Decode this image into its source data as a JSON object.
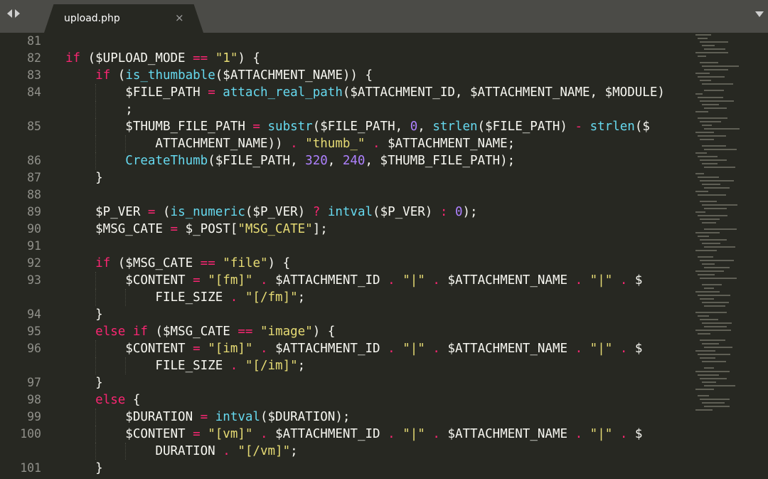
{
  "tab": {
    "title": "upload.php",
    "close": "×"
  },
  "lines": [
    {
      "n": "81",
      "segs": []
    },
    {
      "n": "82",
      "segs": [
        [
          "kw",
          "if"
        ],
        [
          "p",
          " ($UPLOAD_MODE "
        ],
        [
          "op",
          "=="
        ],
        [
          "p",
          " "
        ],
        [
          "str",
          "\"1\""
        ],
        [
          "p",
          ") {"
        ]
      ]
    },
    {
      "n": "83",
      "segs": [
        [
          "p",
          "    "
        ],
        [
          "kw",
          "if"
        ],
        [
          "p",
          " ("
        ],
        [
          "fn",
          "is_thumbable"
        ],
        [
          "p",
          "($ATTACHMENT_NAME)) {"
        ]
      ]
    },
    {
      "n": "84",
      "segs": [
        [
          "p",
          "        $FILE_PATH "
        ],
        [
          "op",
          "="
        ],
        [
          "p",
          " "
        ],
        [
          "fn",
          "attach_real_path"
        ],
        [
          "p",
          "($ATTACHMENT_ID, $ATTACHMENT_NAME, $MODULE)"
        ]
      ]
    },
    {
      "n": "",
      "segs": [
        [
          "p",
          "        ;"
        ]
      ]
    },
    {
      "n": "85",
      "segs": [
        [
          "p",
          "        $THUMB_FILE_PATH "
        ],
        [
          "op",
          "="
        ],
        [
          "p",
          " "
        ],
        [
          "fn",
          "substr"
        ],
        [
          "p",
          "($FILE_PATH, "
        ],
        [
          "num",
          "0"
        ],
        [
          "p",
          ", "
        ],
        [
          "fn",
          "strlen"
        ],
        [
          "p",
          "($FILE_PATH) "
        ],
        [
          "op",
          "-"
        ],
        [
          "p",
          " "
        ],
        [
          "fn",
          "strlen"
        ],
        [
          "p",
          "($"
        ]
      ]
    },
    {
      "n": "",
      "segs": [
        [
          "p",
          "            ATTACHMENT_NAME)) "
        ],
        [
          "op",
          "."
        ],
        [
          "p",
          " "
        ],
        [
          "str",
          "\"thumb_\""
        ],
        [
          "p",
          " "
        ],
        [
          "op",
          "."
        ],
        [
          "p",
          " $ATTACHMENT_NAME;"
        ]
      ]
    },
    {
      "n": "86",
      "segs": [
        [
          "p",
          "        "
        ],
        [
          "fn",
          "CreateThumb"
        ],
        [
          "p",
          "($FILE_PATH, "
        ],
        [
          "num",
          "320"
        ],
        [
          "p",
          ", "
        ],
        [
          "num",
          "240"
        ],
        [
          "p",
          ", $THUMB_FILE_PATH);"
        ]
      ]
    },
    {
      "n": "87",
      "segs": [
        [
          "p",
          "    }"
        ]
      ]
    },
    {
      "n": "88",
      "segs": []
    },
    {
      "n": "89",
      "segs": [
        [
          "p",
          "    $P_VER "
        ],
        [
          "op",
          "="
        ],
        [
          "p",
          " ("
        ],
        [
          "fn",
          "is_numeric"
        ],
        [
          "p",
          "($P_VER) "
        ],
        [
          "op",
          "?"
        ],
        [
          "p",
          " "
        ],
        [
          "fn",
          "intval"
        ],
        [
          "p",
          "($P_VER) "
        ],
        [
          "op",
          ":"
        ],
        [
          "p",
          " "
        ],
        [
          "num",
          "0"
        ],
        [
          "p",
          ");"
        ]
      ]
    },
    {
      "n": "90",
      "segs": [
        [
          "p",
          "    $MSG_CATE "
        ],
        [
          "op",
          "="
        ],
        [
          "p",
          " $_POST["
        ],
        [
          "str",
          "\"MSG_CATE\""
        ],
        [
          "p",
          "];"
        ]
      ]
    },
    {
      "n": "91",
      "segs": []
    },
    {
      "n": "92",
      "segs": [
        [
          "p",
          "    "
        ],
        [
          "kw",
          "if"
        ],
        [
          "p",
          " ($MSG_CATE "
        ],
        [
          "op",
          "=="
        ],
        [
          "p",
          " "
        ],
        [
          "str",
          "\"file\""
        ],
        [
          "p",
          ") {"
        ]
      ]
    },
    {
      "n": "93",
      "segs": [
        [
          "p",
          "        $CONTENT "
        ],
        [
          "op",
          "="
        ],
        [
          "p",
          " "
        ],
        [
          "str",
          "\"[fm]\""
        ],
        [
          "p",
          " "
        ],
        [
          "op",
          "."
        ],
        [
          "p",
          " $ATTACHMENT_ID "
        ],
        [
          "op",
          "."
        ],
        [
          "p",
          " "
        ],
        [
          "str",
          "\"|\""
        ],
        [
          "p",
          " "
        ],
        [
          "op",
          "."
        ],
        [
          "p",
          " $ATTACHMENT_NAME "
        ],
        [
          "op",
          "."
        ],
        [
          "p",
          " "
        ],
        [
          "str",
          "\"|\""
        ],
        [
          "p",
          " "
        ],
        [
          "op",
          "."
        ],
        [
          "p",
          " $"
        ]
      ]
    },
    {
      "n": "",
      "segs": [
        [
          "p",
          "            FILE_SIZE "
        ],
        [
          "op",
          "."
        ],
        [
          "p",
          " "
        ],
        [
          "str",
          "\"[/fm]\""
        ],
        [
          "p",
          ";"
        ]
      ]
    },
    {
      "n": "94",
      "segs": [
        [
          "p",
          "    }"
        ]
      ]
    },
    {
      "n": "95",
      "segs": [
        [
          "p",
          "    "
        ],
        [
          "kw",
          "else"
        ],
        [
          "p",
          " "
        ],
        [
          "kw",
          "if"
        ],
        [
          "p",
          " ($MSG_CATE "
        ],
        [
          "op",
          "=="
        ],
        [
          "p",
          " "
        ],
        [
          "str",
          "\"image\""
        ],
        [
          "p",
          ") {"
        ]
      ]
    },
    {
      "n": "96",
      "segs": [
        [
          "p",
          "        $CONTENT "
        ],
        [
          "op",
          "="
        ],
        [
          "p",
          " "
        ],
        [
          "str",
          "\"[im]\""
        ],
        [
          "p",
          " "
        ],
        [
          "op",
          "."
        ],
        [
          "p",
          " $ATTACHMENT_ID "
        ],
        [
          "op",
          "."
        ],
        [
          "p",
          " "
        ],
        [
          "str",
          "\"|\""
        ],
        [
          "p",
          " "
        ],
        [
          "op",
          "."
        ],
        [
          "p",
          " $ATTACHMENT_NAME "
        ],
        [
          "op",
          "."
        ],
        [
          "p",
          " "
        ],
        [
          "str",
          "\"|\""
        ],
        [
          "p",
          " "
        ],
        [
          "op",
          "."
        ],
        [
          "p",
          " $"
        ]
      ]
    },
    {
      "n": "",
      "segs": [
        [
          "p",
          "            FILE_SIZE "
        ],
        [
          "op",
          "."
        ],
        [
          "p",
          " "
        ],
        [
          "str",
          "\"[/im]\""
        ],
        [
          "p",
          ";"
        ]
      ]
    },
    {
      "n": "97",
      "segs": [
        [
          "p",
          "    }"
        ]
      ]
    },
    {
      "n": "98",
      "segs": [
        [
          "p",
          "    "
        ],
        [
          "kw",
          "else"
        ],
        [
          "p",
          " {"
        ]
      ]
    },
    {
      "n": "99",
      "segs": [
        [
          "p",
          "        $DURATION "
        ],
        [
          "op",
          "="
        ],
        [
          "p",
          " "
        ],
        [
          "fn",
          "intval"
        ],
        [
          "p",
          "($DURATION);"
        ]
      ]
    },
    {
      "n": "100",
      "segs": [
        [
          "p",
          "        $CONTENT "
        ],
        [
          "op",
          "="
        ],
        [
          "p",
          " "
        ],
        [
          "str",
          "\"[vm]\""
        ],
        [
          "p",
          " "
        ],
        [
          "op",
          "."
        ],
        [
          "p",
          " $ATTACHMENT_ID "
        ],
        [
          "op",
          "."
        ],
        [
          "p",
          " "
        ],
        [
          "str",
          "\"|\""
        ],
        [
          "p",
          " "
        ],
        [
          "op",
          "."
        ],
        [
          "p",
          " $ATTACHMENT_NAME "
        ],
        [
          "op",
          "."
        ],
        [
          "p",
          " "
        ],
        [
          "str",
          "\"|\""
        ],
        [
          "p",
          " "
        ],
        [
          "op",
          "."
        ],
        [
          "p",
          " $"
        ]
      ]
    },
    {
      "n": "",
      "segs": [
        [
          "p",
          "            DURATION "
        ],
        [
          "op",
          "."
        ],
        [
          "p",
          " "
        ],
        [
          "str",
          "\"[/vm]\""
        ],
        [
          "p",
          ";"
        ]
      ]
    },
    {
      "n": "101",
      "segs": [
        [
          "p",
          "    }"
        ]
      ]
    }
  ],
  "colors": {
    "background": "#272822",
    "keyword": "#f92672",
    "function": "#66d9ef",
    "string": "#e6db74",
    "number": "#ae81ff",
    "plain": "#f8f8f2",
    "line_number": "#90908a"
  }
}
